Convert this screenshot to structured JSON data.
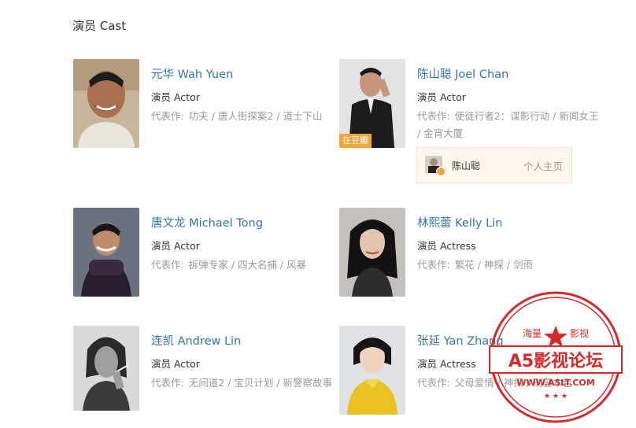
{
  "section_title": "演员 Cast",
  "cast": [
    {
      "name": "元华 Wah Yuen",
      "role": "演员 Actor",
      "works_label": "代表作:",
      "works": "功夫 / 唐人街探案2 / 道士下山",
      "photo": "actor-photo"
    },
    {
      "name": "陈山聪 Joel Chan",
      "role": "演员 Actor",
      "works_label": "代表作:",
      "works": "使徒行者2：谍影行动 / 新闻女王 / 金宵大厦",
      "badge": "在豆瓣",
      "profile_name": "陈山聪",
      "profile_link": "个人主页"
    },
    {
      "name": "唐文龙 Michael Tong",
      "role": "演员 Actor",
      "works_label": "代表作:",
      "works": "拆弹专家 / 四大名捕 / 风暴"
    },
    {
      "name": "林熙蕾 Kelly Lin",
      "role": "演员 Actress",
      "works_label": "代表作:",
      "works": "繁花 / 神探 / 剑雨"
    },
    {
      "name": "连凯 Andrew Lin",
      "role": "演员 Actor",
      "works_label": "代表作:",
      "works": "无间道2 / 宝贝计划 / 新警察故事"
    },
    {
      "name": "张延 Yan Zhang",
      "role": "演员 Actress",
      "works_label": "代表作:",
      "works": "父母爱情 / 神探 / 刑警本色"
    }
  ],
  "watermark": {
    "top_left": "海量",
    "top_right": "影视",
    "main": "A5影视论坛",
    "url": "WWW.A5LT.COM",
    "color": "#d9282a"
  }
}
